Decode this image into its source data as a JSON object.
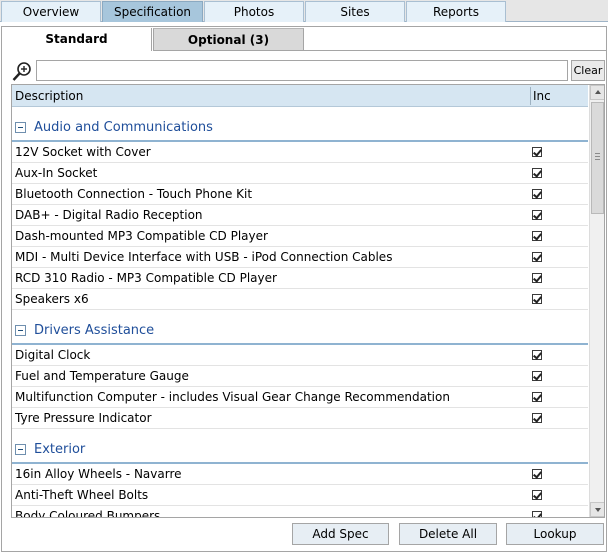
{
  "nav_tabs": [
    {
      "label": "Overview",
      "active": false
    },
    {
      "label": "Specification",
      "active": true
    },
    {
      "label": "Photos",
      "active": false
    },
    {
      "label": "Sites",
      "active": false
    },
    {
      "label": "Reports",
      "active": false
    }
  ],
  "sub_tabs": {
    "standard": "Standard",
    "optional": "Optional (3)"
  },
  "search": {
    "value": "",
    "placeholder": "",
    "clear_label": "Clear",
    "icon": "zoom-search-icon"
  },
  "grid": {
    "columns": [
      "Description",
      "Inc"
    ],
    "groups": [
      {
        "title": "Audio and Communications",
        "items": [
          {
            "desc": "12V Socket with Cover",
            "inc": true
          },
          {
            "desc": "Aux-In Socket",
            "inc": true
          },
          {
            "desc": "Bluetooth Connection - Touch Phone Kit",
            "inc": true
          },
          {
            "desc": "DAB+ - Digital Radio Reception",
            "inc": true
          },
          {
            "desc": "Dash-mounted MP3 Compatible CD Player",
            "inc": true
          },
          {
            "desc": "MDI - Multi Device Interface with USB - iPod Connection Cables",
            "inc": true
          },
          {
            "desc": "RCD 310 Radio - MP3 Compatible CD Player",
            "inc": true
          },
          {
            "desc": "Speakers x6",
            "inc": true
          }
        ]
      },
      {
        "title": "Drivers Assistance",
        "items": [
          {
            "desc": "Digital Clock",
            "inc": true
          },
          {
            "desc": "Fuel and Temperature Gauge",
            "inc": true
          },
          {
            "desc": "Multifunction Computer - includes Visual Gear Change Recommendation",
            "inc": true
          },
          {
            "desc": "Tyre Pressure Indicator",
            "inc": true
          }
        ]
      },
      {
        "title": "Exterior",
        "items": [
          {
            "desc": "16in Alloy Wheels - Navarre",
            "inc": true
          },
          {
            "desc": "Anti-Theft Wheel Bolts",
            "inc": true
          },
          {
            "desc": "Body Coloured Bumpers",
            "inc": true
          }
        ]
      }
    ]
  },
  "buttons": {
    "add_spec": "Add Spec",
    "delete_all": "Delete All",
    "lookup": "Lookup"
  },
  "colors": {
    "active_tab": "#a7c6dc",
    "group_title": "#1f4e9a",
    "header_bg": "#d6e6f2"
  }
}
